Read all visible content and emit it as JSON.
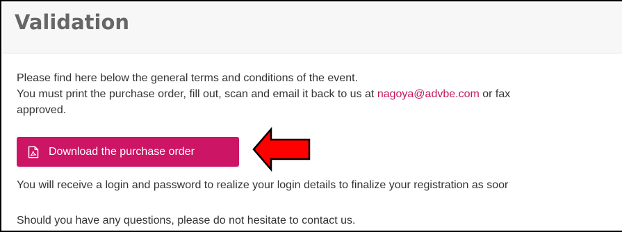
{
  "section": {
    "title": "Validation"
  },
  "content": {
    "line1": "Please find here below the general terms and conditions of the event.",
    "line2_prefix": "You must print the purchase order, fill out, scan and email it back to us at ",
    "email": "nagoya@advbe.com",
    "line2_suffix": " or fax",
    "line3": "approved.",
    "download_label": "Download the purchase order",
    "login_info": "You will receive a login and password to realize your login details to finalize your registration as soor",
    "contact_info": "Should you have any questions, please do not hesitate to contact us."
  },
  "icons": {
    "download": "pdf-file-icon",
    "annotation": "red-arrow-left-icon"
  },
  "colors": {
    "accent": "#cc1565",
    "link": "#c2185b",
    "arrow_fill": "#ff0000",
    "title": "#666666"
  }
}
